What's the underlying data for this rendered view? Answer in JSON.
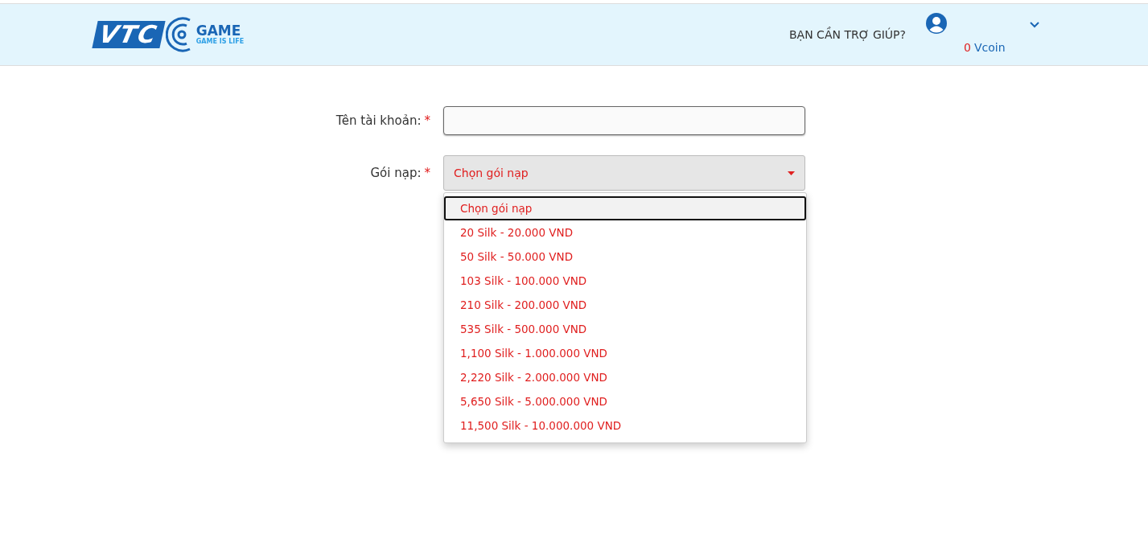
{
  "header": {
    "logo": {
      "mark": "VTC",
      "word": "GAME",
      "tagline": "GAME IS LIFE"
    },
    "help_link": "BẠN CẦN TRỢ GIÚP?",
    "balance": {
      "amount": "0",
      "unit": "Vcoin"
    }
  },
  "form": {
    "fields": [
      {
        "kind": "text",
        "label": "Tên tài khoản:",
        "required_mark": "*"
      },
      {
        "kind": "select",
        "label": "Gói nạp:",
        "required_mark": "*",
        "value": "Chọn gói nạp",
        "expanded": true,
        "options": [
          {
            "label": "Chọn gói nạp",
            "selected": true
          },
          {
            "label": "20 Silk - 20.000 VND",
            "selected": false
          },
          {
            "label": "50 Silk - 50.000 VND",
            "selected": false
          },
          {
            "label": "103 Silk - 100.000 VND",
            "selected": false
          },
          {
            "label": "210 Silk - 200.000 VND",
            "selected": false
          },
          {
            "label": "535 Silk - 500.000 VND",
            "selected": false
          },
          {
            "label": "1,100 Silk - 1.000.000 VND",
            "selected": false
          },
          {
            "label": "2,220 Silk - 2.000.000 VND",
            "selected": false
          },
          {
            "label": "5,650 Silk - 5.000.000 VND",
            "selected": false
          },
          {
            "label": "11,500 Silk - 10.000.000 VND",
            "selected": false
          }
        ]
      }
    ]
  }
}
